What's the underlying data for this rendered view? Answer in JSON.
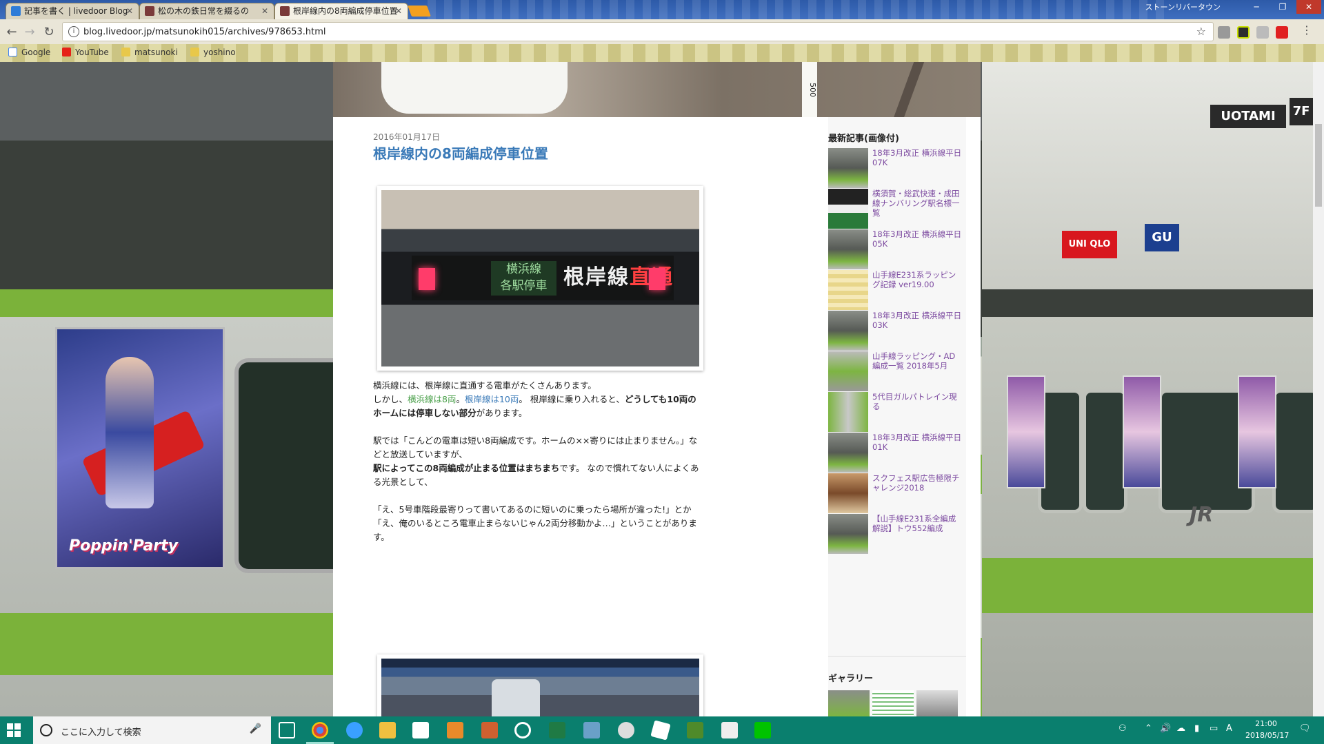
{
  "browser": {
    "tabs": [
      {
        "label": "記事を書く | livedoor Blog",
        "active": false
      },
      {
        "label": "松の木の鉄日常を綴るの",
        "active": false
      },
      {
        "label": "根岸線内の8両編成停車位置",
        "active": true
      }
    ],
    "window_title": "ストーンリバータウン",
    "url": "blog.livedoor.jp/matsunokih015/archives/978653.html",
    "bookmarks": [
      "Google",
      "YouTube",
      "matsunoki",
      "yoshino"
    ]
  },
  "post": {
    "date": "2016年01月17日",
    "title": "根岸線内の8両編成停車位置",
    "led": {
      "line_top": "横浜線",
      "line_bottom": "各駅停車",
      "dest_main": "根岸線",
      "dest_red": "直通"
    },
    "p1_line1": "横浜線には、根岸線に直通する電車がたくさんあります。",
    "p1_a": "しかし、",
    "p1_green": "横浜線は8両",
    "p1_sep": "。",
    "p1_blue": "根岸線は10両",
    "p1_b": "。 根岸線に乗り入れると、",
    "p1_bold": "どうしても10両のホームには停車しない部分",
    "p1_c": "があります。",
    "p2_line1": "駅では「こんどの電車は短い8両編成です。ホームの××寄りには止まりません。」などと放送していますが、",
    "p2_bold": "駅によってこの8両編成が止まる位置はまちまち",
    "p2_tail": "です。 なので慣れてない人によくある光景として、",
    "p3_line1": "「え、5号車階段最寄りって書いてあるのに短いのに乗ったら場所が違った!」とか",
    "p3_line2": "「え、俺のいるところ電車止まらないじゃん2両分移動かよ…」ということがあります。"
  },
  "sidebar": {
    "recent_title": "最新記事(画像付)",
    "recent": [
      "18年3月改正 横浜線平日07K",
      "横須賀・総武快速・成田線ナンバリング駅名標一覧",
      "18年3月改正 横浜線平日05K",
      "山手線E231系ラッピング記録 ver19.00",
      "18年3月改正 横浜線平日03K",
      "山手線ラッピング・AD編成一覧 2018年5月",
      "5代目ガルパトレイン現る",
      "18年3月改正 横浜線平日01K",
      "スクフェス駅広告極限チャレンジ2018",
      "【山手線E231系全編成解説】トウ552編成"
    ],
    "gallery_title": "ギャラリー"
  },
  "background": {
    "poster_caption": "Poppin'Party",
    "signs": {
      "uotami": "UOTAMI",
      "floor": "7F",
      "uniqlo": "UNI QLO",
      "gu": "GU",
      "jr": "JR"
    },
    "header_marker": "500"
  },
  "taskbar": {
    "search_placeholder": "ここに入力して検索",
    "time": "21:00",
    "date": "2018/05/17"
  },
  "colors": {
    "accent_title": "#3a7ab8",
    "link_visited": "#7c4aa0",
    "yokohama_green": "#4aa04a",
    "taskbar": "#0a7f6e"
  }
}
